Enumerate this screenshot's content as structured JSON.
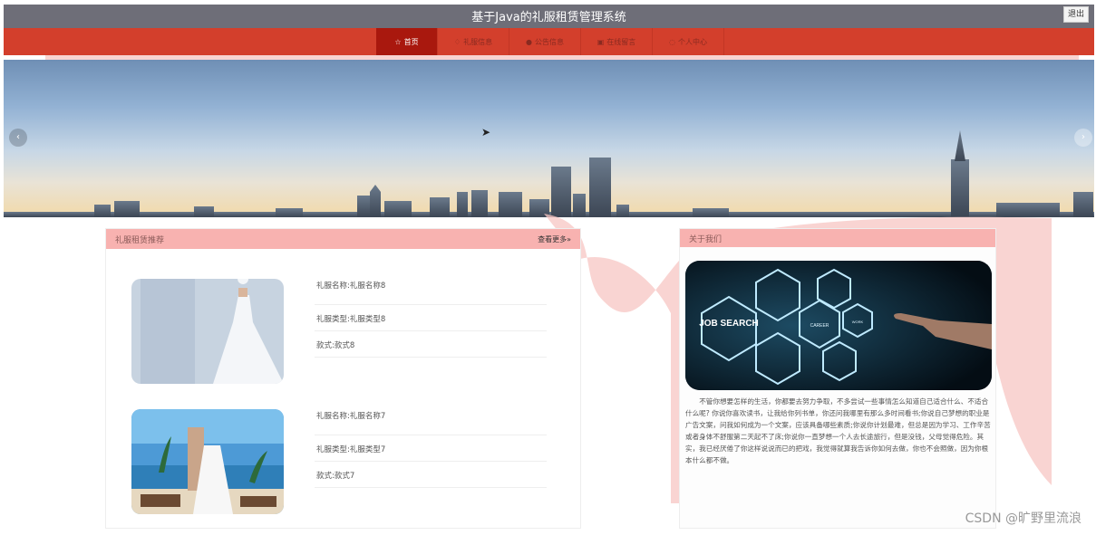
{
  "header": {
    "title": "基于Java的礼服租赁管理系统",
    "logout_label": "退出"
  },
  "nav": [
    {
      "label": "首页",
      "icon": "star-icon"
    },
    {
      "label": "礼服信息",
      "icon": "shirt-icon"
    },
    {
      "label": "公告信息",
      "icon": "bell-icon"
    },
    {
      "label": "在线留言",
      "icon": "chat-icon"
    },
    {
      "label": "个人中心",
      "icon": "user-icon"
    }
  ],
  "banner": {
    "prev_icon": "chevron-left-icon",
    "next_icon": "chevron-right-icon"
  },
  "recommend": {
    "title": "礼服租赁推荐",
    "more_label": "查看更多»",
    "items": [
      {
        "name": "礼服名称:礼服名称8",
        "type": "礼服类型:礼服类型8",
        "style": "款式:款式8"
      },
      {
        "name": "礼服名称:礼服名称7",
        "type": "礼服类型:礼服类型7",
        "style": "款式:款式7"
      }
    ]
  },
  "about": {
    "title": "关于我们",
    "image_text": {
      "main": "JOB SEARCH",
      "tag1": "CAREER",
      "tag2": "WORK"
    },
    "text": "不管你想要怎样的生活，你都要去努力争取，不多尝试一些事情怎么知道自己适合什么、不适合什么呢? 你说你喜欢读书，让我给你列书单，你还问我哪里有那么多时间看书;你说自己梦想的职业是广告文案，问我如何成为一个文案，应该具备哪些素质;你说你计划最难，但总是因为学习、工作辛苦或者身体不舒服第二天起不了床;你说你一直梦想一个人去长途旅行，但是没钱，父母觉得危险。其实，我已经厌倦了你这样说说而已的把戏，我觉得就算我告诉你如何去做，你也不会照做，因为你根本什么都不做。"
  },
  "watermark": "CSDN @旷野里流浪"
}
